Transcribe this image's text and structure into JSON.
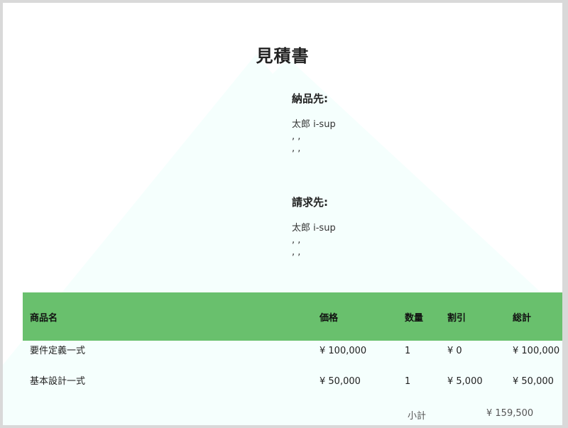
{
  "document": {
    "title": "見積書"
  },
  "delivery": {
    "heading": "納品先:",
    "lines": [
      "太郎 i-sup",
      ", ,",
      ", ,"
    ]
  },
  "billing": {
    "heading": "請求先:",
    "lines": [
      "太郎 i-sup",
      ", ,",
      ", ,"
    ]
  },
  "table": {
    "headers": [
      "商品名",
      "価格",
      "数量",
      "割引",
      "総計"
    ],
    "rows": [
      [
        "要件定義一式",
        "¥ 100,000",
        "1",
        "¥ 0",
        "¥ 100,000"
      ],
      [
        "基本設計一式",
        "¥ 50,000",
        "1",
        "¥ 5,000",
        "¥ 50,000"
      ]
    ]
  },
  "summary": {
    "subtotal_label": "小計",
    "subtotal_value": "¥ 159,500"
  },
  "colors": {
    "header_green": "#69c06d",
    "background_shape": "#f5fffd"
  }
}
